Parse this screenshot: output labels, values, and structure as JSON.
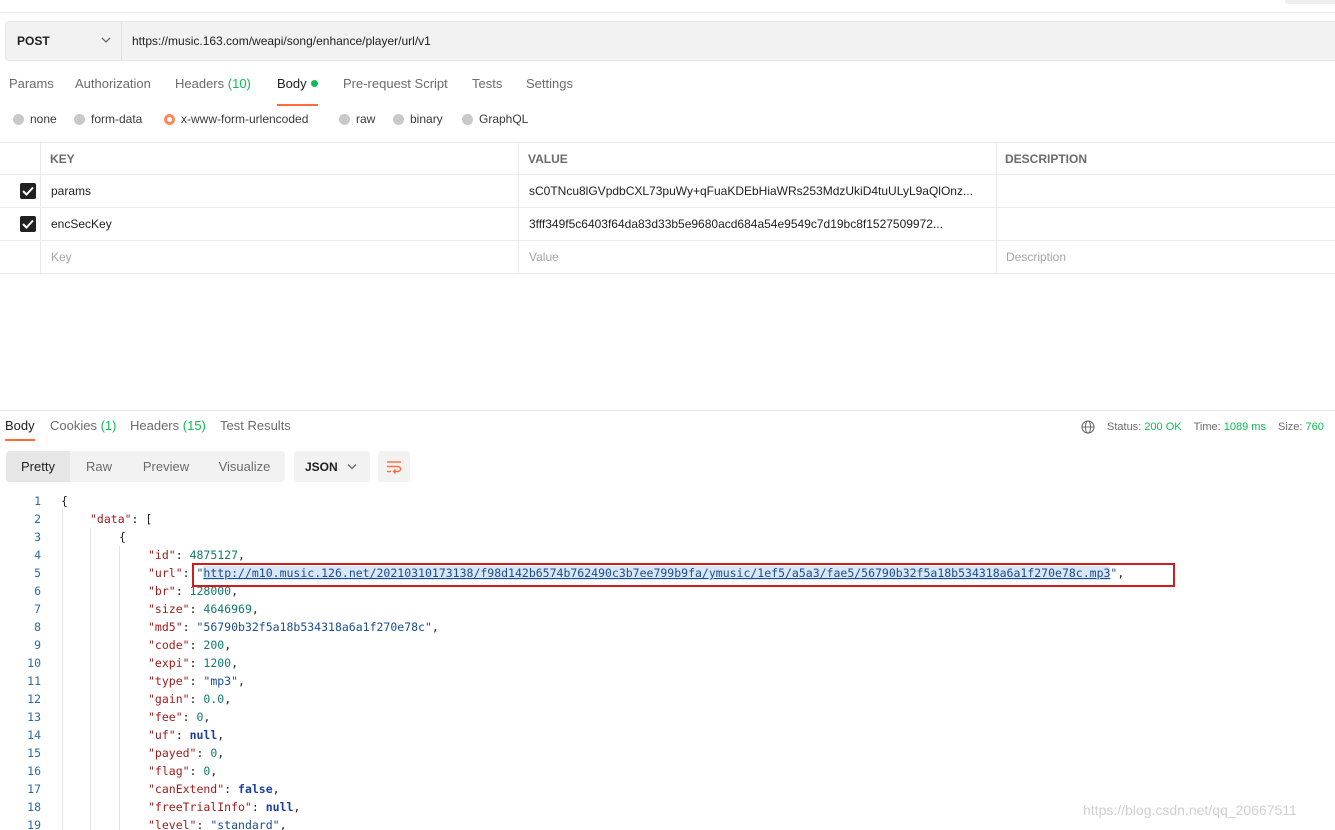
{
  "request": {
    "method": "POST",
    "url": "https://music.163.com/weapi/song/enhance/player/url/v1"
  },
  "request_tabs": {
    "params": "Params",
    "authorization": "Authorization",
    "headers": "Headers",
    "headers_count": "(10)",
    "body": "Body",
    "prerequest": "Pre-request Script",
    "tests": "Tests",
    "settings": "Settings"
  },
  "body_types": {
    "none": "none",
    "form_data": "form-data",
    "urlencoded": "x-www-form-urlencoded",
    "raw": "raw",
    "binary": "binary",
    "graphql": "GraphQL",
    "selected": "x-www-form-urlencoded"
  },
  "kv_table": {
    "headers": {
      "key": "KEY",
      "value": "VALUE",
      "description": "DESCRIPTION"
    },
    "rows": [
      {
        "key": "params",
        "value": "sC0TNcu8lGVpdbCXL73puWy+qFuaKDEbHiaWRs253MdzUkiD4tuULyL9aQlOnz...",
        "description": "",
        "checked": true
      },
      {
        "key": "encSecKey",
        "value": "3fff349f5c6403f64da83d33b5e9680acd684a54e9549c7d19bc8f1527509972...",
        "description": "",
        "checked": true
      }
    ],
    "placeholders": {
      "key": "Key",
      "value": "Value",
      "description": "Description"
    }
  },
  "response_tabs": {
    "body": "Body",
    "cookies": "Cookies",
    "cookies_count": "(1)",
    "headers": "Headers",
    "headers_count": "(15)",
    "test_results": "Test Results"
  },
  "response_status": {
    "status_label": "Status:",
    "status_value": "200 OK",
    "time_label": "Time:",
    "time_value": "1089 ms",
    "size_label": "Size:",
    "size_value": "760"
  },
  "view_modes": {
    "pretty": "Pretty",
    "raw": "Raw",
    "preview": "Preview",
    "visualize": "Visualize"
  },
  "format_select": "JSON",
  "json_body": {
    "line_numbers": [
      "1",
      "2",
      "3",
      "4",
      "5",
      "6",
      "7",
      "8",
      "9",
      "10",
      "11",
      "12",
      "13",
      "14",
      "15",
      "16",
      "17",
      "18",
      "19"
    ],
    "open_brace": "{",
    "data_key": "\"data\"",
    "data_open": ": [",
    "item_open": "{",
    "id_key": "\"id\"",
    "id_val": "4875127",
    "url_key": "\"url\"",
    "url_val": "http://m10.music.126.net/20210310173138/f98d142b6574b762490c3b7ee799b9fa/ymusic/1ef5/a5a3/fae5/56790b32f5a18b534318a6a1f270e78c.mp3",
    "br_key": "\"br\"",
    "br_val": "128000",
    "size_key": "\"size\"",
    "size_val": "4646969",
    "md5_key": "\"md5\"",
    "md5_val": "\"56790b32f5a18b534318a6a1f270e78c\"",
    "code_key": "\"code\"",
    "code_val": "200",
    "expi_key": "\"expi\"",
    "expi_val": "1200",
    "type_key": "\"type\"",
    "type_val": "\"mp3\"",
    "gain_key": "\"gain\"",
    "gain_val": "0.0",
    "fee_key": "\"fee\"",
    "fee_val": "0",
    "uf_key": "\"uf\"",
    "uf_val": "null",
    "payed_key": "\"payed\"",
    "payed_val": "0",
    "flag_key": "\"flag\"",
    "flag_val": "0",
    "canextend_key": "\"canExtend\"",
    "canextend_val": "false",
    "freetrial_key": "\"freeTrialInfo\"",
    "freetrial_val": "null",
    "level_key": "\"level\"",
    "level_val": "\"standard\""
  },
  "watermark": "https://blog.csdn.net/qq_20667511",
  "colors": {
    "accent": "#ff6c37",
    "green": "#0cbb52",
    "highlight_box": "#d01c1c"
  }
}
